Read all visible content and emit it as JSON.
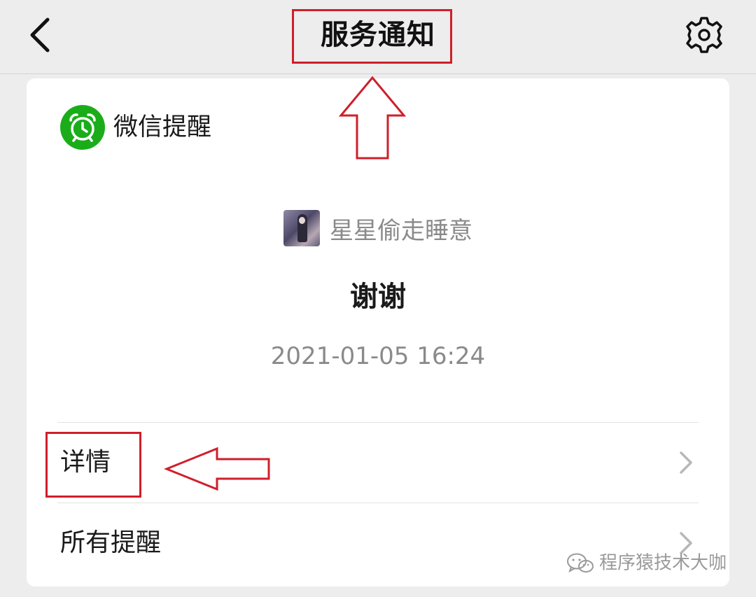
{
  "header": {
    "title": "服务通知",
    "back_icon": "chevron-left-icon",
    "settings_icon": "gear-icon"
  },
  "card": {
    "source": {
      "name": "微信提醒",
      "icon": "alarm-clock-icon",
      "icon_color": "#1aad19"
    },
    "sender": {
      "name": "星星偷走睡意"
    },
    "message": {
      "title": "谢谢",
      "time": "2021-01-05 16:24"
    },
    "rows": [
      {
        "label": "详情",
        "icon": "chevron-right-icon"
      },
      {
        "label": "所有提醒",
        "icon": "chevron-right-icon"
      }
    ]
  },
  "annotations": {
    "color": "#cf1f2b"
  },
  "watermark": {
    "text": "程序猿技术大咖",
    "icon": "wechat-logo-icon"
  }
}
